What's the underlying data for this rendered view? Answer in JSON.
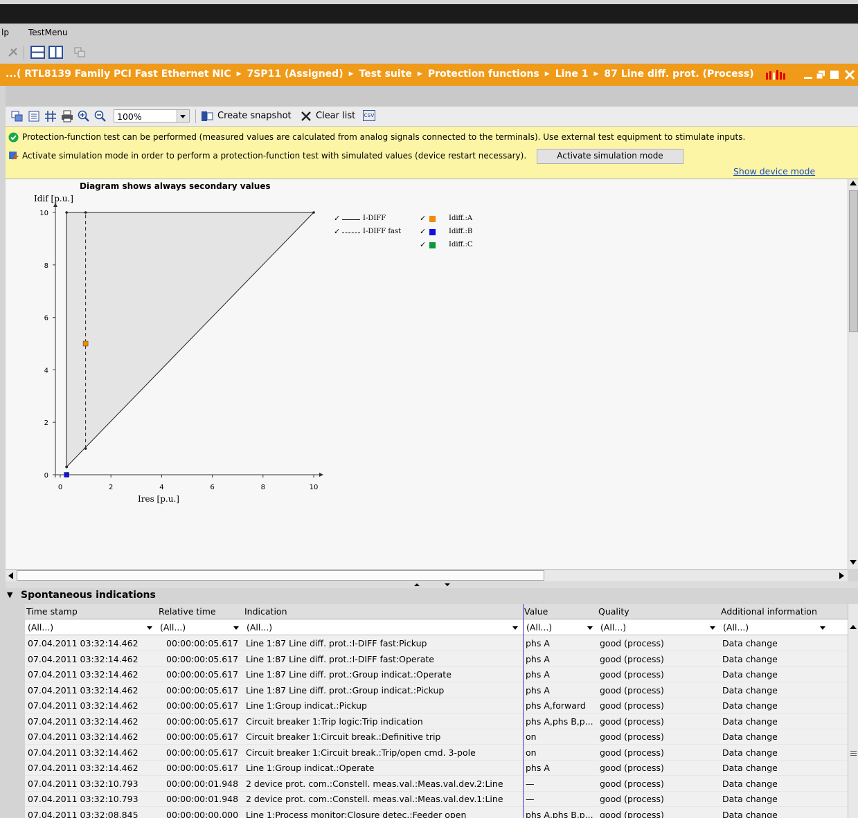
{
  "menu": {
    "help": "lp",
    "test_menu": "TestMenu"
  },
  "breadcrumb": [
    "...( RTL8139 Family PCI Fast Ethernet NIC",
    "7SP11 (Assigned)",
    "Test suite",
    "Protection functions",
    "Line 1",
    "87 Line diff. prot. (Process)"
  ],
  "toolbar": {
    "zoom": "100%",
    "create_snapshot": "Create snapshot",
    "clear_list": "Clear list",
    "csv": "csv"
  },
  "info": {
    "line1": "Protection-function test can be performed (measured values are calculated from analog signals connected to the terminals). Use external test equipment to stimulate inputs.",
    "line2": "Activate simulation mode in order to perform a protection-function test with simulated values (device restart necessary).",
    "activate_button": "Activate simulation mode",
    "show_device_mode": "Show device mode"
  },
  "colors": {
    "accent": "#f09a19",
    "info_bg": "#fdf5a6",
    "phase_a": "#f28c00",
    "phase_b": "#1010e0",
    "phase_c": "#0a9a3a"
  },
  "chart_data": {
    "type": "line",
    "title": "Diagram shows always secondary values",
    "xlabel": "Ires [p.u.]",
    "ylabel": "Idif [p.u.]",
    "xlim": [
      0,
      10
    ],
    "ylim": [
      0,
      10
    ],
    "x_ticks": [
      0,
      2,
      4,
      6,
      8,
      10
    ],
    "y_ticks": [
      0,
      2,
      4,
      6,
      8,
      10
    ],
    "series": [
      {
        "name": "I-DIFF",
        "style": "solid",
        "points": [
          [
            0.25,
            0.3
          ],
          [
            0.25,
            10
          ],
          [
            10,
            10
          ],
          [
            0.25,
            0.3
          ]
        ]
      },
      {
        "name": "I-DIFF fast",
        "style": "dashed",
        "points": [
          [
            1,
            1
          ],
          [
            1,
            10
          ]
        ]
      }
    ],
    "markers": [
      {
        "name": "Idiff.:A",
        "color": "#f28c00",
        "x": 1,
        "y": 5
      },
      {
        "name": "Idiff.:B",
        "color": "#1010e0",
        "x": 0.25,
        "y": 0
      },
      {
        "name": "Idiff.:C",
        "color": "#0a9a3a",
        "x": null,
        "y": null
      }
    ]
  },
  "panel": {
    "title": "Spontaneous indications"
  },
  "table": {
    "headers": [
      "Time stamp",
      "Relative time",
      "Indication",
      "Value",
      "Quality",
      "Additional information"
    ],
    "filter": "(All...)",
    "rows": [
      [
        "07.04.2011 03:32:14.462",
        "00:00:00:05.617",
        "Line 1:87 Line diff. prot.:I-DIFF fast:Pickup",
        "phs A",
        "good (process)",
        "Data change"
      ],
      [
        "07.04.2011 03:32:14.462",
        "00:00:00:05.617",
        "Line 1:87 Line diff. prot.:I-DIFF fast:Operate",
        "phs A",
        "good (process)",
        "Data change"
      ],
      [
        "07.04.2011 03:32:14.462",
        "00:00:00:05.617",
        "Line 1:87 Line diff. prot.:Group indicat.:Operate",
        "phs A",
        "good (process)",
        "Data change"
      ],
      [
        "07.04.2011 03:32:14.462",
        "00:00:00:05.617",
        "Line 1:87 Line diff. prot.:Group indicat.:Pickup",
        "phs A",
        "good (process)",
        "Data change"
      ],
      [
        "07.04.2011 03:32:14.462",
        "00:00:00:05.617",
        "Line 1:Group indicat.:Pickup",
        "phs A,forward",
        "good (process)",
        "Data change"
      ],
      [
        "07.04.2011 03:32:14.462",
        "00:00:00:05.617",
        "Circuit breaker 1:Trip logic:Trip indication",
        "phs A,phs B,p...",
        "good (process)",
        "Data change"
      ],
      [
        "07.04.2011 03:32:14.462",
        "00:00:00:05.617",
        "Circuit breaker 1:Circuit break.:Definitive trip",
        "on",
        "good (process)",
        "Data change"
      ],
      [
        "07.04.2011 03:32:14.462",
        "00:00:00:05.617",
        "Circuit breaker 1:Circuit break.:Trip/open cmd. 3-pole",
        "on",
        "good (process)",
        "Data change"
      ],
      [
        "07.04.2011 03:32:14.462",
        "00:00:00:05.617",
        "Line 1:Group indicat.:Operate",
        "phs A",
        "good (process)",
        "Data change"
      ],
      [
        "07.04.2011 03:32:10.793",
        "00:00:00:01.948",
        "2 device prot. com.:Constell. meas.val.:Meas.val.dev.2:Line",
        "—",
        "good (process)",
        "Data change"
      ],
      [
        "07.04.2011 03:32:10.793",
        "00:00:00:01.948",
        "2 device prot. com.:Constell. meas.val.:Meas.val.dev.1:Line",
        "—",
        "good (process)",
        "Data change"
      ],
      [
        "07.04.2011 03:32:08.845",
        "00:00:00:00.000",
        "Line 1:Process monitor:Closure detec.:Feeder open",
        "phs A,phs B,p...",
        "good (process)",
        "Data change"
      ]
    ]
  }
}
